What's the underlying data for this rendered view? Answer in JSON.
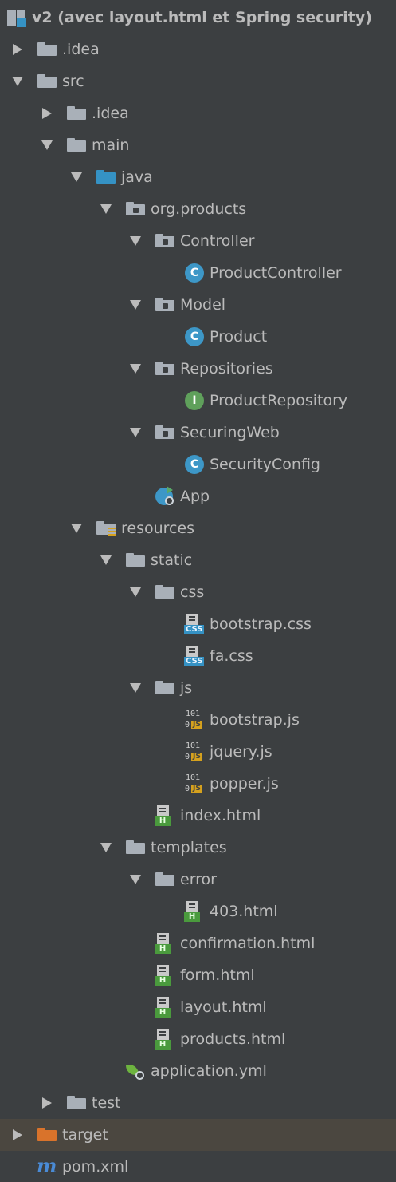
{
  "project_tree": {
    "root": "v2 (avec layout.html et Spring security)",
    "nodes": [
      {
        "label": ".idea",
        "depth": 0,
        "state": "collapsed",
        "icon": "folder-icon"
      },
      {
        "label": "src",
        "depth": 0,
        "state": "expanded",
        "icon": "folder-icon"
      },
      {
        "label": ".idea",
        "depth": 1,
        "state": "collapsed",
        "icon": "folder-icon"
      },
      {
        "label": "main",
        "depth": 1,
        "state": "expanded",
        "icon": "folder-icon"
      },
      {
        "label": "java",
        "depth": 2,
        "state": "expanded",
        "icon": "source-folder-icon"
      },
      {
        "label": "org.products",
        "depth": 3,
        "state": "expanded",
        "icon": "package-icon"
      },
      {
        "label": "Controller",
        "depth": 4,
        "state": "expanded",
        "icon": "package-icon"
      },
      {
        "label": "ProductController",
        "depth": 5,
        "state": "leaf",
        "icon": "class-icon"
      },
      {
        "label": "Model",
        "depth": 4,
        "state": "expanded",
        "icon": "package-icon"
      },
      {
        "label": "Product",
        "depth": 5,
        "state": "leaf",
        "icon": "class-icon"
      },
      {
        "label": "Repositories",
        "depth": 4,
        "state": "expanded",
        "icon": "package-icon"
      },
      {
        "label": "ProductRepository",
        "depth": 5,
        "state": "leaf",
        "icon": "interface-icon"
      },
      {
        "label": "SecuringWeb",
        "depth": 4,
        "state": "expanded",
        "icon": "package-icon"
      },
      {
        "label": "SecurityConfig",
        "depth": 5,
        "state": "leaf",
        "icon": "class-icon"
      },
      {
        "label": "App",
        "depth": 4,
        "state": "leaf",
        "icon": "spring-boot-app-icon"
      },
      {
        "label": "resources",
        "depth": 2,
        "state": "expanded",
        "icon": "resources-folder-icon"
      },
      {
        "label": "static",
        "depth": 3,
        "state": "expanded",
        "icon": "folder-icon"
      },
      {
        "label": "css",
        "depth": 4,
        "state": "expanded",
        "icon": "folder-icon"
      },
      {
        "label": "bootstrap.css",
        "depth": 5,
        "state": "leaf",
        "icon": "css-file-icon"
      },
      {
        "label": "fa.css",
        "depth": 5,
        "state": "leaf",
        "icon": "css-file-icon"
      },
      {
        "label": "js",
        "depth": 4,
        "state": "expanded",
        "icon": "folder-icon"
      },
      {
        "label": "bootstrap.js",
        "depth": 5,
        "state": "leaf",
        "icon": "js-file-icon"
      },
      {
        "label": "jquery.js",
        "depth": 5,
        "state": "leaf",
        "icon": "js-file-icon"
      },
      {
        "label": "popper.js",
        "depth": 5,
        "state": "leaf",
        "icon": "js-file-icon"
      },
      {
        "label": "index.html",
        "depth": 4,
        "state": "leaf",
        "icon": "html-file-icon"
      },
      {
        "label": "templates",
        "depth": 3,
        "state": "expanded",
        "icon": "folder-icon"
      },
      {
        "label": "error",
        "depth": 4,
        "state": "expanded",
        "icon": "folder-icon"
      },
      {
        "label": "403.html",
        "depth": 5,
        "state": "leaf",
        "icon": "html-file-icon"
      },
      {
        "label": "confirmation.html",
        "depth": 4,
        "state": "leaf",
        "icon": "html-file-icon"
      },
      {
        "label": "form.html",
        "depth": 4,
        "state": "leaf",
        "icon": "html-file-icon"
      },
      {
        "label": "layout.html",
        "depth": 4,
        "state": "leaf",
        "icon": "html-file-icon"
      },
      {
        "label": "products.html",
        "depth": 4,
        "state": "leaf",
        "icon": "html-file-icon"
      },
      {
        "label": "application.yml",
        "depth": 3,
        "state": "leaf",
        "icon": "spring-config-icon"
      },
      {
        "label": "test",
        "depth": 1,
        "state": "collapsed",
        "icon": "folder-icon"
      },
      {
        "label": "target",
        "depth": 0,
        "state": "collapsed",
        "icon": "excluded-folder-icon",
        "selected": true
      },
      {
        "label": "pom.xml",
        "depth": 0,
        "state": "leaf",
        "icon": "maven-icon"
      }
    ]
  },
  "colors": {
    "background": "#3c3f41",
    "text": "#bbbbbb",
    "selected_row": "#4b4740",
    "folder": "#a9b0b8",
    "source_folder": "#3592c4",
    "excluded_folder": "#d9732b",
    "class_badge": "#3d97c7",
    "interface_badge": "#5fa05b",
    "html_tag": "#4a9a3d",
    "js_tag": "#d5a11e",
    "maven": "#4a8bd6",
    "spring": "#6db33f"
  },
  "icon_glyphs": {
    "class_letter": "C",
    "interface_letter": "I",
    "css_tag": "CSS",
    "html_tag": "H",
    "js_tag": "JS",
    "js_bits": "101",
    "js_zero": "0",
    "maven_letter": "m"
  }
}
